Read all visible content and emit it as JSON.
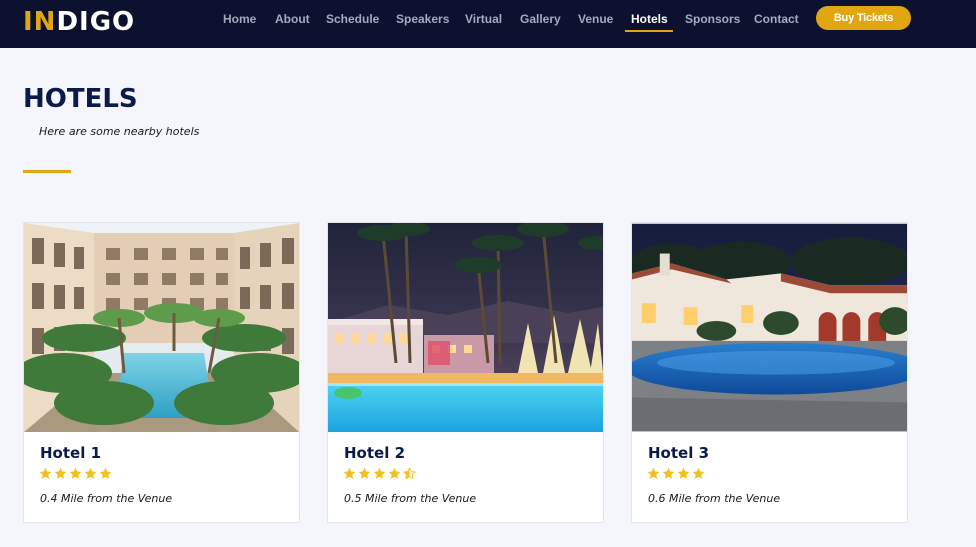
{
  "header": {
    "logo_accent": "IN",
    "logo_rest": "DIGO",
    "nav": [
      {
        "label": "Home"
      },
      {
        "label": "About"
      },
      {
        "label": "Schedule"
      },
      {
        "label": "Speakers"
      },
      {
        "label": "Virtual"
      },
      {
        "label": "Gallery"
      },
      {
        "label": "Venue"
      },
      {
        "label": "Hotels",
        "active": true
      },
      {
        "label": "Sponsors"
      },
      {
        "label": "Contact"
      }
    ],
    "buy_button": "Buy Tickets"
  },
  "page": {
    "title": "HOTELS",
    "subtitle": "Here are some nearby hotels"
  },
  "hotels": [
    {
      "name": "Hotel 1",
      "rating": 5,
      "distance": "0.4 Mile from the Venue"
    },
    {
      "name": "Hotel 2",
      "rating": 4.5,
      "distance": "0.5 Mile from the Venue"
    },
    {
      "name": "Hotel 3",
      "rating": 4,
      "distance": "0.6 Mile from the Venue"
    }
  ],
  "colors": {
    "navbar": "#0c1130",
    "accent_gold": "#e0a712",
    "heading_navy": "#0c1a4a",
    "background": "#f5f6fc",
    "star": "#f4c01e"
  },
  "icons": {
    "star": "star-icon",
    "half_star": "star-half-icon"
  }
}
